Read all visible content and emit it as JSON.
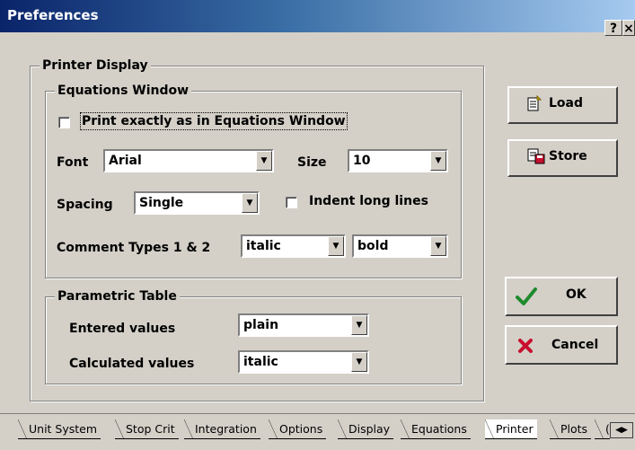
{
  "window": {
    "title": "Preferences",
    "help_glyph": "?",
    "close_glyph": "×"
  },
  "printer_display": {
    "label": "Printer Display",
    "equations_window": {
      "label": "Equations Window",
      "print_exact_label": "Print exactly as in Equations Window",
      "print_exact_checked": false,
      "font_label": "Font",
      "font_value": "Arial",
      "size_label": "Size",
      "size_value": "10",
      "spacing_label": "Spacing",
      "spacing_value": "Single",
      "indent_label": "Indent long lines",
      "indent_checked": false,
      "comment_label": "Comment Types 1 & 2",
      "comment1_value": "italic",
      "comment2_value": "bold"
    },
    "parametric_table": {
      "label": "Parametric Table",
      "entered_label": "Entered values",
      "entered_value": "plain",
      "calculated_label": "Calculated values",
      "calculated_value": "italic"
    }
  },
  "buttons": {
    "load": "Load",
    "store": "Store",
    "ok": "OK",
    "cancel": "Cancel"
  },
  "tabs": [
    {
      "label": "Unit System",
      "active": false
    },
    {
      "label": "Stop Crit",
      "active": false
    },
    {
      "label": "Integration",
      "active": false
    },
    {
      "label": "Options",
      "active": false
    },
    {
      "label": "Display",
      "active": false
    },
    {
      "label": "Equations",
      "active": false
    },
    {
      "label": "Printer",
      "active": true
    },
    {
      "label": "Plots",
      "active": false
    },
    {
      "label": "(",
      "active": false
    }
  ],
  "colors": {
    "face": "#d4d0c8",
    "title_start": "#0a246a",
    "title_end": "#a6caf0",
    "ok_check": "#1f8a2c",
    "cancel_x": "#c8102e"
  }
}
